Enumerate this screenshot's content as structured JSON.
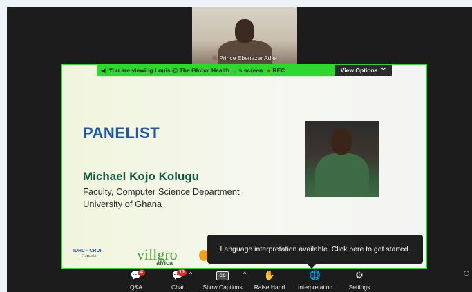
{
  "participant": {
    "name": "Prince Ebenezer Adjei"
  },
  "share_banner": {
    "viewing_text": "You are viewing  Louis @ The Global Health ...  's screen",
    "rec_label": "REC",
    "view_options_label": "View Options"
  },
  "slide": {
    "heading": "PANELIST",
    "speaker_name": "Michael Kojo Kolugu",
    "speaker_title": "Faculty, Computer Science Department",
    "speaker_affiliation": "University of Ghana",
    "logos": {
      "idrc": "IDRC · CRDI",
      "idrc_sub": "Canada",
      "villgro": "villgro",
      "villgro_sub": "africa"
    }
  },
  "toast": {
    "message": "Language interpretation available. Click here to get started."
  },
  "toolbar": {
    "qa_label": "Q&A",
    "qa_badge": "4",
    "chat_label": "Chat",
    "chat_badge": "10",
    "captions_label": "Show Captions",
    "captions_icon_text": "CC",
    "raise_hand_label": "Raise Hand",
    "interpretation_label": "Interpretation",
    "settings_label": "Settings"
  },
  "colors": {
    "share_border": "#2fd82f",
    "heading": "#1e5aa6",
    "speaker_name": "#0f5a3c",
    "badge": "#e02828"
  }
}
